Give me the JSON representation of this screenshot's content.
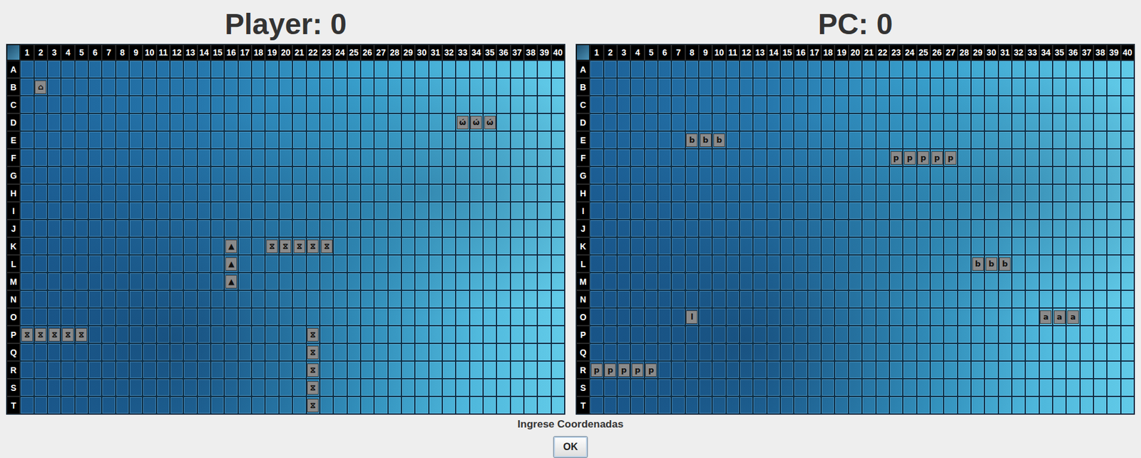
{
  "boards": [
    {
      "title": "Player: 0",
      "ships": [
        {
          "symbol": "⌂",
          "row": "B",
          "col": 2,
          "length": 1,
          "orientation": "horizontal"
        },
        {
          "symbol": "ώ",
          "row": "D",
          "col": 33,
          "length": 3,
          "orientation": "horizontal"
        },
        {
          "symbol": "▲",
          "row": "K",
          "col": 16,
          "length": 3,
          "orientation": "vertical"
        },
        {
          "symbol": "⧖",
          "row": "K",
          "col": 19,
          "length": 5,
          "orientation": "horizontal"
        },
        {
          "symbol": "⧖",
          "row": "P",
          "col": 1,
          "length": 5,
          "orientation": "horizontal"
        },
        {
          "symbol": "⧖",
          "row": "P",
          "col": 22,
          "length": 5,
          "orientation": "vertical"
        }
      ]
    },
    {
      "title": "PC: 0",
      "ships": [
        {
          "symbol": "b",
          "row": "E",
          "col": 8,
          "length": 3,
          "orientation": "horizontal"
        },
        {
          "symbol": "p",
          "row": "F",
          "col": 23,
          "length": 5,
          "orientation": "horizontal"
        },
        {
          "symbol": "b",
          "row": "L",
          "col": 29,
          "length": 3,
          "orientation": "horizontal"
        },
        {
          "symbol": "l",
          "row": "O",
          "col": 8,
          "length": 1,
          "orientation": "horizontal"
        },
        {
          "symbol": "a",
          "row": "O",
          "col": 34,
          "length": 3,
          "orientation": "horizontal"
        },
        {
          "symbol": "p",
          "row": "R",
          "col": 1,
          "length": 5,
          "orientation": "horizontal"
        }
      ]
    }
  ],
  "columns": [
    "1",
    "2",
    "3",
    "4",
    "5",
    "6",
    "7",
    "8",
    "9",
    "10",
    "11",
    "12",
    "13",
    "14",
    "15",
    "16",
    "17",
    "18",
    "19",
    "20",
    "21",
    "22",
    "23",
    "24",
    "25",
    "26",
    "27",
    "28",
    "29",
    "30",
    "31",
    "32",
    "33",
    "34",
    "35",
    "36",
    "37",
    "38",
    "39",
    "40"
  ],
  "rows": [
    "A",
    "B",
    "C",
    "D",
    "E",
    "F",
    "G",
    "H",
    "I",
    "J",
    "K",
    "L",
    "M",
    "N",
    "O",
    "P",
    "Q",
    "R",
    "S",
    "T"
  ],
  "prompt": "Ingrese Coordenadas",
  "buttons": [
    "OK"
  ]
}
